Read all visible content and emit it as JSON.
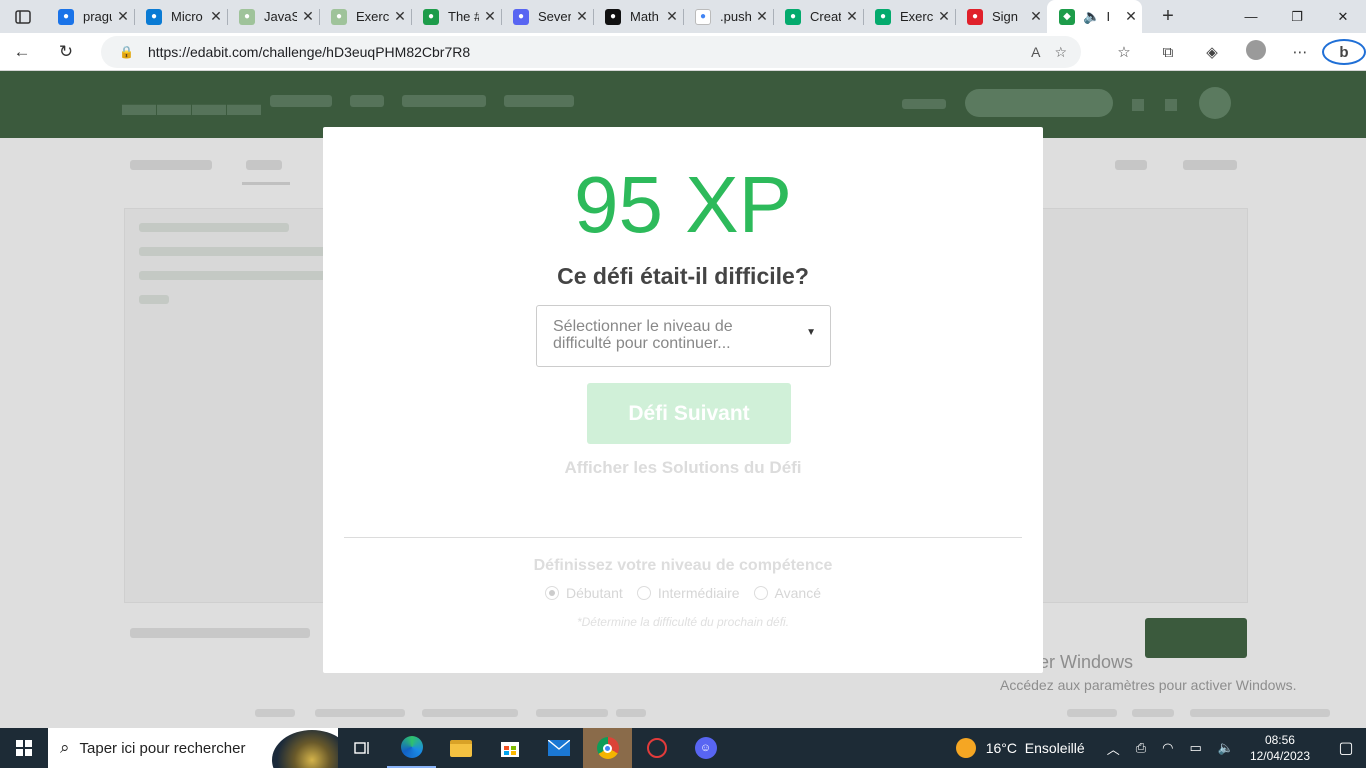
{
  "browser": {
    "tabs": [
      {
        "title": "pragu",
        "favicon": "search-favicon",
        "color": "#1a73e8",
        "width": 88
      },
      {
        "title": "Micro",
        "favicon": "edge-favicon",
        "color": "#0a7bd4",
        "width": 93
      },
      {
        "title": "JavaS",
        "favicon": "w3schools-favicon",
        "color": "#9fc39a",
        "width": 92
      },
      {
        "title": "Exerc",
        "favicon": "w3schools-favicon",
        "color": "#9fc39a",
        "width": 92
      },
      {
        "title": "The #",
        "favicon": "edabit-favicon",
        "color": "#1d9c4a",
        "width": 90
      },
      {
        "title": "Sever",
        "favicon": "code-favicon",
        "color": "#5865f2",
        "width": 92
      },
      {
        "title": "Math",
        "favicon": "medium-favicon",
        "color": "#111111",
        "width": 90
      },
      {
        "title": ".push",
        "favicon": "google-favicon",
        "color": "#ffffff",
        "width": 90
      },
      {
        "title": "Creat",
        "favicon": "w3schools-favicon",
        "color": "#04aa6d",
        "width": 90
      },
      {
        "title": "Exerc",
        "favicon": "w3schools-favicon",
        "color": "#04aa6d",
        "width": 92
      },
      {
        "title": "Sign",
        "favicon": "opera-favicon",
        "color": "#e0202a",
        "width": 92
      }
    ],
    "active_tab": {
      "title": "I",
      "favicon": "edabit-favicon",
      "color": "#1d9c4a"
    },
    "url": "https://edabit.com/challenge/hD3euqPHM82Cbr7R8"
  },
  "modal": {
    "xp": "95 XP",
    "question": "Ce défi était-il difficile?",
    "select_placeholder": "Sélectionner le niveau de difficulté pour continuer...",
    "next_button": "Défi Suivant",
    "solutions_link": "Afficher les Solutions du Défi",
    "skill_title": "Définissez votre niveau de compétence",
    "skill_levels": [
      {
        "label": "Débutant",
        "selected": true
      },
      {
        "label": "Intermédiaire",
        "selected": false
      },
      {
        "label": "Avancé",
        "selected": false
      }
    ],
    "hint": "*Détermine la difficulté du prochain défi."
  },
  "watermark": {
    "line1": "Activer Windows",
    "line2": "Accédez aux paramètres pour activer Windows."
  },
  "taskbar": {
    "search_placeholder": "Taper ici pour rechercher",
    "weather": "16°C  Ensoleillé",
    "time": "08:56",
    "date": "12/04/2023"
  },
  "colors": {
    "xp_green": "#2dba5b",
    "button_disabled_green": "#d0f0d8",
    "site_header": "#3b5a3d"
  }
}
